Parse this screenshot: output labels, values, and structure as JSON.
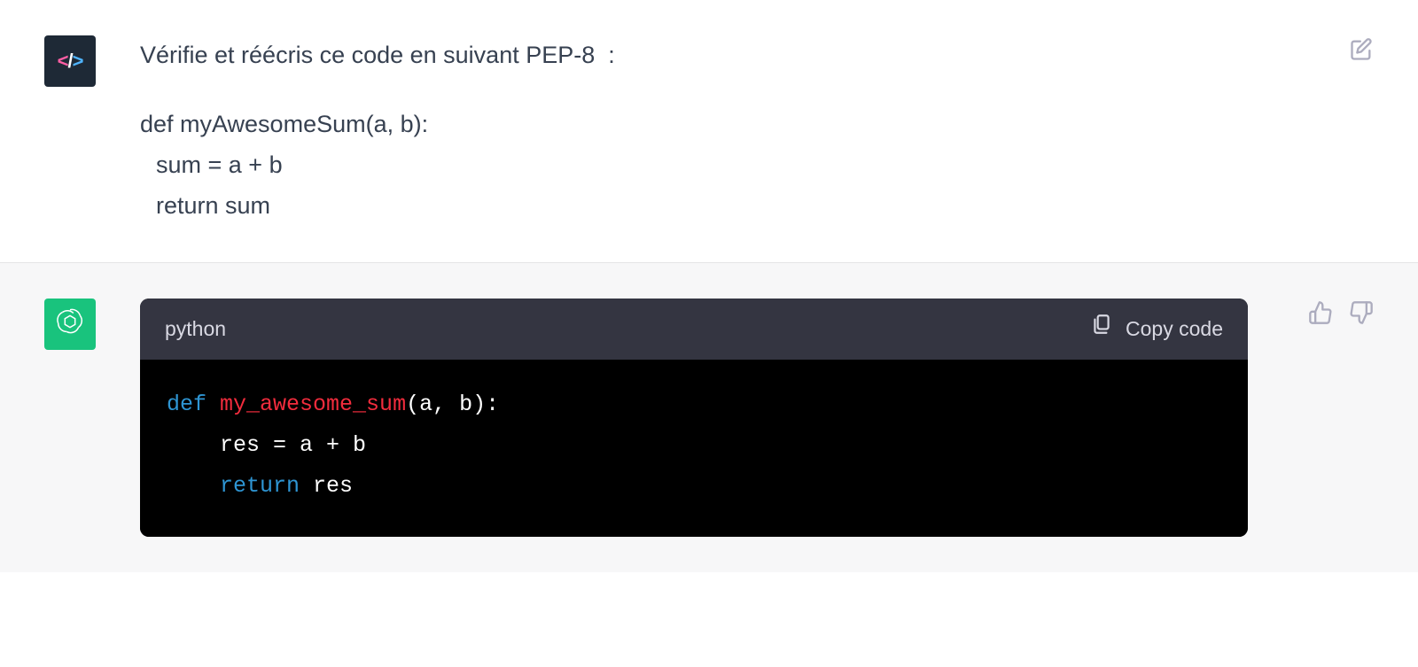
{
  "user_message": {
    "heading": "Vérifie et réécris ce code en suivant PEP-8  :",
    "code_line1": "def myAwesomeSum(a, b):",
    "code_line2": "sum = a + b",
    "code_line3": "return sum"
  },
  "assistant_message": {
    "code_language": "python",
    "copy_label": "Copy code",
    "code": {
      "l1": {
        "kw": "def",
        "sp1": " ",
        "fn": "my_awesome_sum",
        "rest": "(a, b):"
      },
      "l2": {
        "indent": "    ",
        "body": "res = a + b"
      },
      "l3": {
        "indent": "    ",
        "kw": "return",
        "sp": " ",
        "rest": "res"
      }
    }
  },
  "icons": {
    "user_avatar": "code-brackets-icon",
    "assistant_avatar": "openai-logo-icon",
    "edit": "edit-icon",
    "thumbs_up": "thumbs-up-icon",
    "thumbs_down": "thumbs-down-icon",
    "clipboard": "clipboard-icon"
  }
}
